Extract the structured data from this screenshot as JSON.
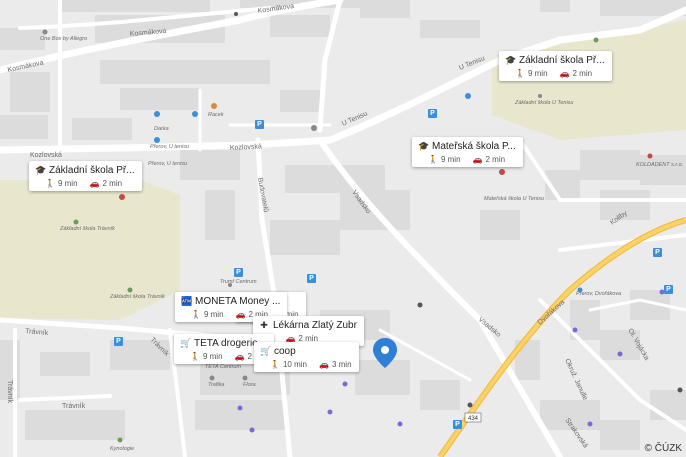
{
  "streets": {
    "kosmakova_1": "Kosmákova",
    "kosmakova_2": "Kosmákova",
    "kosmakova_3": "Kosmákova",
    "u_teniss_1": "U Tenisu",
    "u_teniss_2": "U Tenisu",
    "kozlovska_1": "Kozlovská",
    "kozlovska_2": "Kozlovská",
    "budovatelu": "Budovatelů",
    "vsadsko_1": "Vsadsko",
    "vsadsko_2": "Vsadsko",
    "dvorakova": "Dvořákova",
    "travnik_1": "Trávník",
    "travnik_2": "Trávník",
    "travnik_3": "Trávník",
    "travnik_4": "Trávník",
    "kollby": "Kollby",
    "olomoucka": "Ol. Vojácka",
    "ol_rolla": "Okruž. Janulle",
    "strakovska": "Strakovská",
    "road_number": "434"
  },
  "places": {
    "one_box": "One Box by Allegro",
    "darka": "Darka",
    "racek": "Racek",
    "prerov_u_tenisu_1": "Přerov, U tenisu",
    "prerov_u_tenisu_2": "Přerov, U tenisu",
    "zs_travnik_1": "Základní škola Trávník",
    "zs_travnik_2": "Základní škola Trávník",
    "trumf_centrum": "Trumf Centrum",
    "teta_centrum": "TETA Centrum",
    "trafika": "Trafika",
    "flora": "Flora",
    "kynologie": "Kynologie",
    "zs_u_tenisu": "Základní škola U Tenisu",
    "ms_u_tenisu": "Mateřská škola U Tenisu",
    "koldadent": "KOLDADENT s.r.o.",
    "prerov_dvorakova": "Přerov, Dvořákova"
  },
  "cards": [
    {
      "name": "Základní škola Př...",
      "icon": "school-icon",
      "walk": "9 min",
      "drive": "2 min"
    },
    {
      "name": "Mateřská škola P...",
      "icon": "school-icon",
      "walk": "9 min",
      "drive": "2 min"
    },
    {
      "name": "Základní škola Př...",
      "icon": "school-icon",
      "walk": "9 min",
      "drive": "2 min"
    },
    {
      "name": "MONETA Money ...",
      "icon": "atm-icon",
      "walk": "9 min",
      "drive": "2 min"
    },
    {
      "name": "ta",
      "icon": "",
      "walk": "",
      "drive": "2 min"
    },
    {
      "name": "Lékárna Zlatý Zubr",
      "icon": "pharmacy-icon",
      "walk": "n",
      "drive": "2 min"
    },
    {
      "name": "TETA drogerie",
      "icon": "shop-icon",
      "walk": "9 min",
      "drive": "2 min"
    },
    {
      "name": "coop",
      "icon": "shop-icon",
      "walk": "10 min",
      "drive": "3 min"
    }
  ],
  "copyright": "© ČÚZK",
  "colors": {
    "map_bg": "#ebebeb",
    "road": "#ffffff",
    "school_area": "#e8e6cc",
    "building": "#dcdcdc",
    "main_road": "#f6c445",
    "pin": "#2f7fd6"
  }
}
